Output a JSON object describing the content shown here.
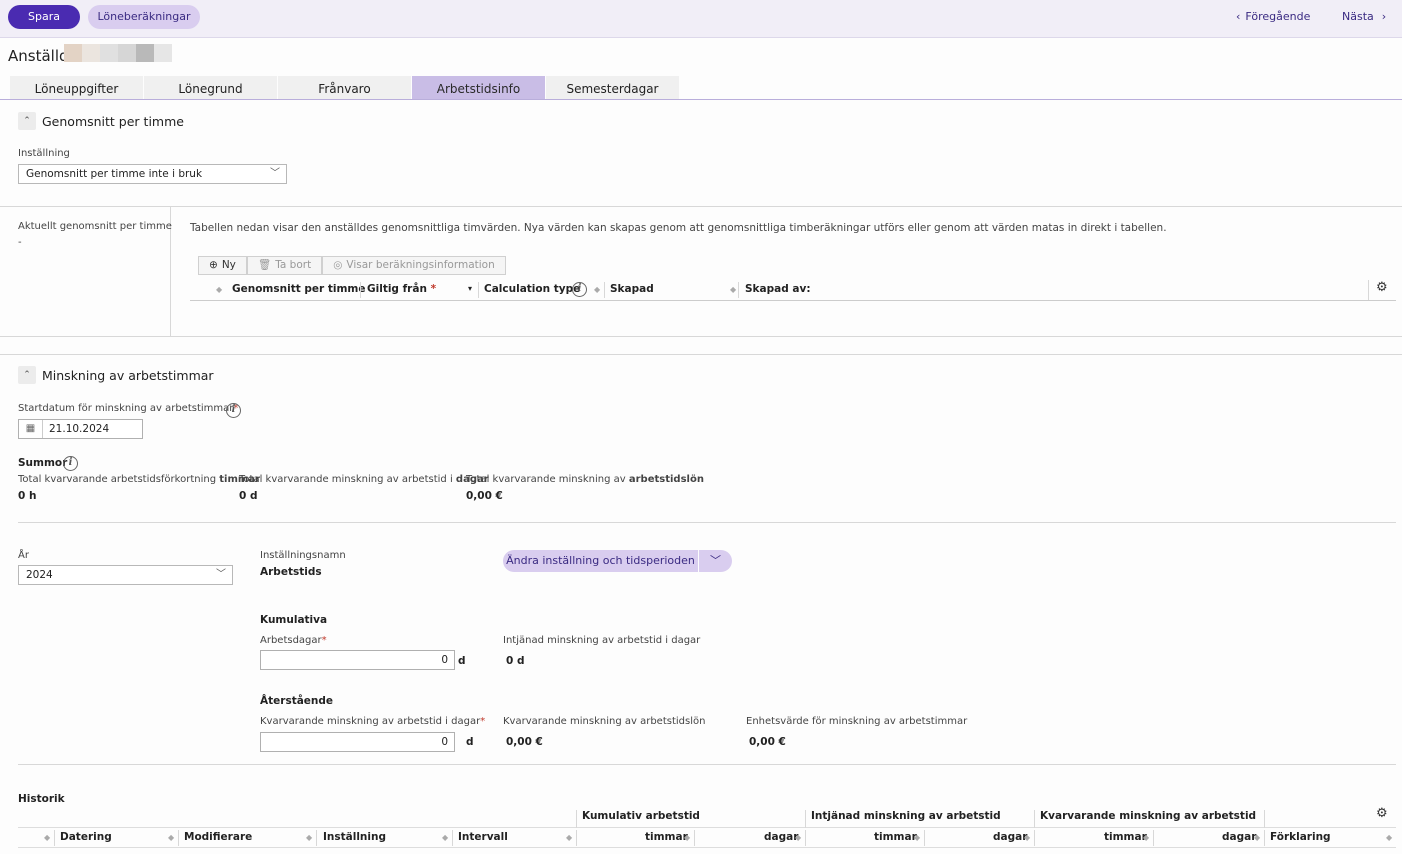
{
  "toolbar": {
    "save_label": "Spara",
    "calc_label": "Löneberäkningar",
    "prev_label": "Föregående",
    "next_label": "Nästa"
  },
  "employee": {
    "title": "Anställd"
  },
  "tabs": [
    {
      "label": "Löneuppgifter"
    },
    {
      "label": "Lönegrund"
    },
    {
      "label": "Frånvaro"
    },
    {
      "label": "Arbetstidsinfo"
    },
    {
      "label": "Semesterdagar"
    }
  ],
  "avg": {
    "section_title": "Genomsnitt per timme",
    "setting_label": "Inställning",
    "setting_value": "Genomsnitt per timme inte i bruk",
    "current_label": "Aktuellt genomsnitt per timme",
    "current_value": "-",
    "description": "Tabellen nedan visar den anställdes genomsnittliga timvärden. Nya värden kan skapas genom att genomsnittliga timberäkningar utförs eller genom att värden matas in direkt i tabellen.",
    "btn_new": "Ny",
    "btn_delete": "Ta bort",
    "btn_info": "Visar beräkningsinformation",
    "columns": [
      "Genomsnitt per timme",
      "Giltig från",
      "Calculation type",
      "Skapad",
      "Skapad av:"
    ]
  },
  "reduction": {
    "section_title": "Minskning av arbetstimmar",
    "start_label": "Startdatum för minskning av arbetstimmar",
    "start_value": "21.10.2024",
    "sums_label": "Summor",
    "sum1_label_pre": "Total kvarvarande arbetstidsförkortning ",
    "sum1_label_bold": "timmar",
    "sum1_value": "0 h",
    "sum2_label_pre": "Total kvarvarande minskning av arbetstid i ",
    "sum2_label_bold": "dagar",
    "sum2_value": "0 d",
    "sum3_label_pre": "Total kvarvarande minskning av ",
    "sum3_label_bold": "arbetstidslön",
    "sum3_value": "0,00 €",
    "year_label": "År",
    "year_value": "2024",
    "setting_name_label": "Inställningsnamn",
    "setting_name_value": "Arbetstids",
    "change_btn": "Ändra inställning och tidsperioden",
    "cumulative_title": "Kumulativa",
    "workdays_label": "Arbetsdagar",
    "workdays_value": "0",
    "workdays_unit": "d",
    "earned_label": "Intjänad minskning av arbetstid i dagar",
    "earned_value": "0 d",
    "remaining_title": "Återstående",
    "remaining_days_label": "Kvarvarande minskning av arbetstid i dagar",
    "remaining_days_value": "0",
    "remaining_days_unit": "d",
    "remaining_pay_label": "Kvarvarande minskning av arbetstidslön",
    "remaining_pay_value": "0,00 €",
    "unit_value_label": "Enhetsvärde för minskning av arbetstimmar",
    "unit_value_value": "0,00 €"
  },
  "history": {
    "title": "Historik",
    "group1": "Kumulativ arbetstid",
    "group2": "Intjänad minskning av arbetstid",
    "group3": "Kvarvarande minskning av arbetstid",
    "columns": [
      "Datering",
      "Modifierare",
      "Inställning",
      "Intervall",
      "timmar",
      "dagar",
      "timmar",
      "dagar",
      "timmar",
      "dagar",
      "Förklaring"
    ]
  }
}
